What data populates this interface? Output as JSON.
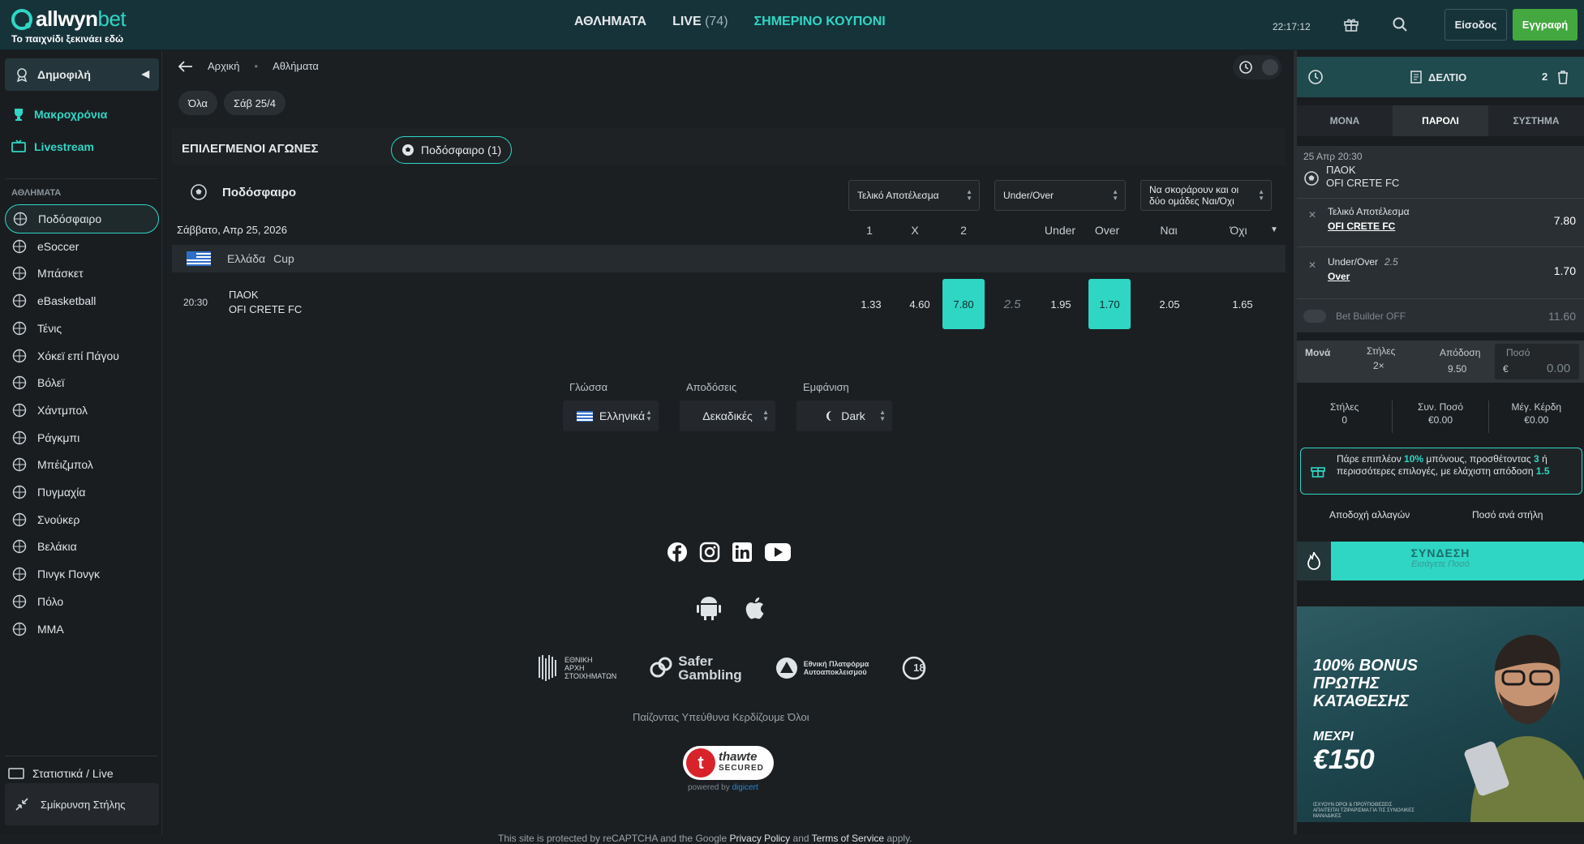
{
  "brand": {
    "name": "allwyn",
    "suffix": "bet",
    "tagline": "Το παιχνίδι ξεκινάει εδώ"
  },
  "nav": {
    "sports": "ΑΘΛΗΜΑΤΑ",
    "live": "LIVE",
    "live_count": "(74)",
    "coupon": "ΣΗΜΕΡΙΝΟ ΚΟΥΠΟΝΙ"
  },
  "header": {
    "clock": "22:17:12",
    "login": "Είσοδος",
    "register": "Εγγραφή"
  },
  "sidebar": {
    "popular": "Δημοφιλή",
    "longterm": "Μακροχρόνια",
    "livestream": "Livestream",
    "section": "ΑΘΛΗΜΑΤΑ",
    "items": [
      {
        "label": "Ποδόσφαιρο",
        "icon": "soccer-icon"
      },
      {
        "label": "eSoccer",
        "icon": "esoccer-icon"
      },
      {
        "label": "Μπάσκετ",
        "icon": "basketball-icon"
      },
      {
        "label": "eBasketball",
        "icon": "ebasketball-icon"
      },
      {
        "label": "Τένις",
        "icon": "tennis-icon"
      },
      {
        "label": "Χόκεϊ επί Πάγου",
        "icon": "ice-hockey-icon"
      },
      {
        "label": "Βόλεϊ",
        "icon": "volleyball-icon"
      },
      {
        "label": "Χάντμπολ",
        "icon": "handball-icon"
      },
      {
        "label": "Ράγκμπι",
        "icon": "rugby-icon"
      },
      {
        "label": "Μπέιζμπολ",
        "icon": "baseball-icon"
      },
      {
        "label": "Πυγμαχία",
        "icon": "boxing-icon"
      },
      {
        "label": "Σνούκερ",
        "icon": "snooker-icon"
      },
      {
        "label": "Βελάκια",
        "icon": "darts-icon"
      },
      {
        "label": "Πινγκ Πονγκ",
        "icon": "table-tennis-icon"
      },
      {
        "label": "Πόλο",
        "icon": "polo-icon"
      },
      {
        "label": "MMA",
        "icon": "mma-icon"
      }
    ],
    "stats": "Στατιστικά / Live",
    "collapse": "Σμίκρυνση Στήλης"
  },
  "main": {
    "breadcrumb": [
      "Αρχική",
      "Αθλήματα"
    ],
    "chips": [
      "Όλα",
      "Σάβ 25/4"
    ],
    "section_title": "ΕΠΙΛΕΓΜΕΝΟΙ ΑΓΩΝΕΣ",
    "sport_chip": "Ποδόσφαιρο (1)",
    "sport": "Ποδόσφαιρο",
    "markets": [
      "Τελικό Αποτέλεσμα",
      "Under/Over",
      "Να σκοράρουν και οι δύο ομάδες Ναι/Όχι"
    ],
    "date": "Σάββατο, Απρ 25, 2026",
    "columns": [
      "1",
      "X",
      "2",
      "Under",
      "Over",
      "Ναι",
      "Όχι"
    ],
    "league": {
      "country": "Ελλάδα",
      "name": "Cup"
    },
    "match": {
      "time": "20:30",
      "home": "ΠΑΟΚ",
      "away": "OFI CRETE FC",
      "odds": {
        "1": "1.33",
        "X": "4.60",
        "2": "7.80",
        "line": "2.5",
        "under": "1.95",
        "over": "1.70",
        "yes": "2.05",
        "no": "1.65"
      }
    }
  },
  "footer": {
    "language_label": "Γλώσσα",
    "language": "Ελληνικά",
    "odds_label": "Αποδόσεις",
    "odds_format": "Δεκαδικές",
    "theme_label": "Εμφάνιση",
    "theme": "Dark",
    "reg1": [
      "ΕΘΝΙΚΗ",
      "ΑΡΧΗ",
      "ΣΤΟΙΧΗΜΑΤΩΝ"
    ],
    "reg2": [
      "Safer",
      "Gambling"
    ],
    "reg3": [
      "Εθνική Πλατφόρμα",
      "Αυτοαποκλεισμού"
    ],
    "age": "18",
    "responsible": "Παίζοντας Υπεύθυνα Κερδίζουμε Όλοι",
    "thawte": "thawte",
    "thawte_sub": "SECURED",
    "powered": "powered by",
    "digicert": "digicert",
    "recaptcha_pre": "This site is protected by reCAPTCHA and the Google",
    "privacy": "Privacy Policy",
    "and": "and",
    "terms": "Terms of Service",
    "apply": "apply."
  },
  "slip": {
    "title": "ΔΕΛΤΙΟ",
    "count": "2",
    "tabs": [
      "ΜΟΝΑ",
      "ΠΑΡΟΛΙ",
      "ΣΥΣΤΗΜΑ"
    ],
    "date": "25 Απρ  20:30",
    "home": "ΠΑΟΚ",
    "away": "OFI CRETE FC",
    "legs": [
      {
        "market": "Τελικό Αποτέλεσμα",
        "pick": "OFI CRETE FC",
        "odd": "7.80",
        "line": ""
      },
      {
        "market": "Under/Over",
        "pick": "Over",
        "odd": "1.70",
        "line": "2.5"
      }
    ],
    "bet_builder": "Bet Builder OFF",
    "bet_builder_odd": "11.60",
    "stake": {
      "mona": "Μονά",
      "stiles": "Στήλες",
      "stiles_val": "2×",
      "apodosi": "Απόδοση",
      "apodosi_val": "9.50",
      "poso": "Ποσό",
      "currency": "€",
      "amount": "0.00"
    },
    "totals": [
      {
        "label": "Στήλες",
        "value": "0"
      },
      {
        "label": "Συν. Ποσό",
        "value": "€0.00"
      },
      {
        "label": "Μέγ. Κέρδη",
        "value": "€0.00"
      }
    ],
    "promo": {
      "a": "Πάρε επιπλέον ",
      "b": "10%",
      "c": " μπόνους, προσθέτοντας ",
      "d": "3",
      "e": " ή περισσότερες επιλογές, με ελάχιστη απόδοση ",
      "f": "1.5"
    },
    "accept": "Αποδοχή αλλαγών",
    "per_line": "Ποσό ανά στήλη",
    "connect": "ΣΥΝΔΕΣΗ",
    "connect_sub": "Εισάγετε Ποσό",
    "banner": {
      "l1": "100% BONUS",
      "l2": "ΠΡΩΤΗΣ",
      "l3": "ΚΑΤΑΘΕΣΗΣ",
      "l4": "ΜΕΧΡΙ",
      "l5": "€150",
      "l6": "ΙΣΧΥΟΥΝ ΟΡΟΙ & ΠΡΟΫΠΟΘΕΣΕΙΣ",
      "l7": "ΑΠΑΙΤΕΙΤΑΙ ΤΖΙΡΑΡΙΣΜΑ ΓΙΑ ΤΙΣ ΣΥΝΟΛΙΚΕΣ ΜΑΝΑΔΙΚΕΣ"
    }
  }
}
